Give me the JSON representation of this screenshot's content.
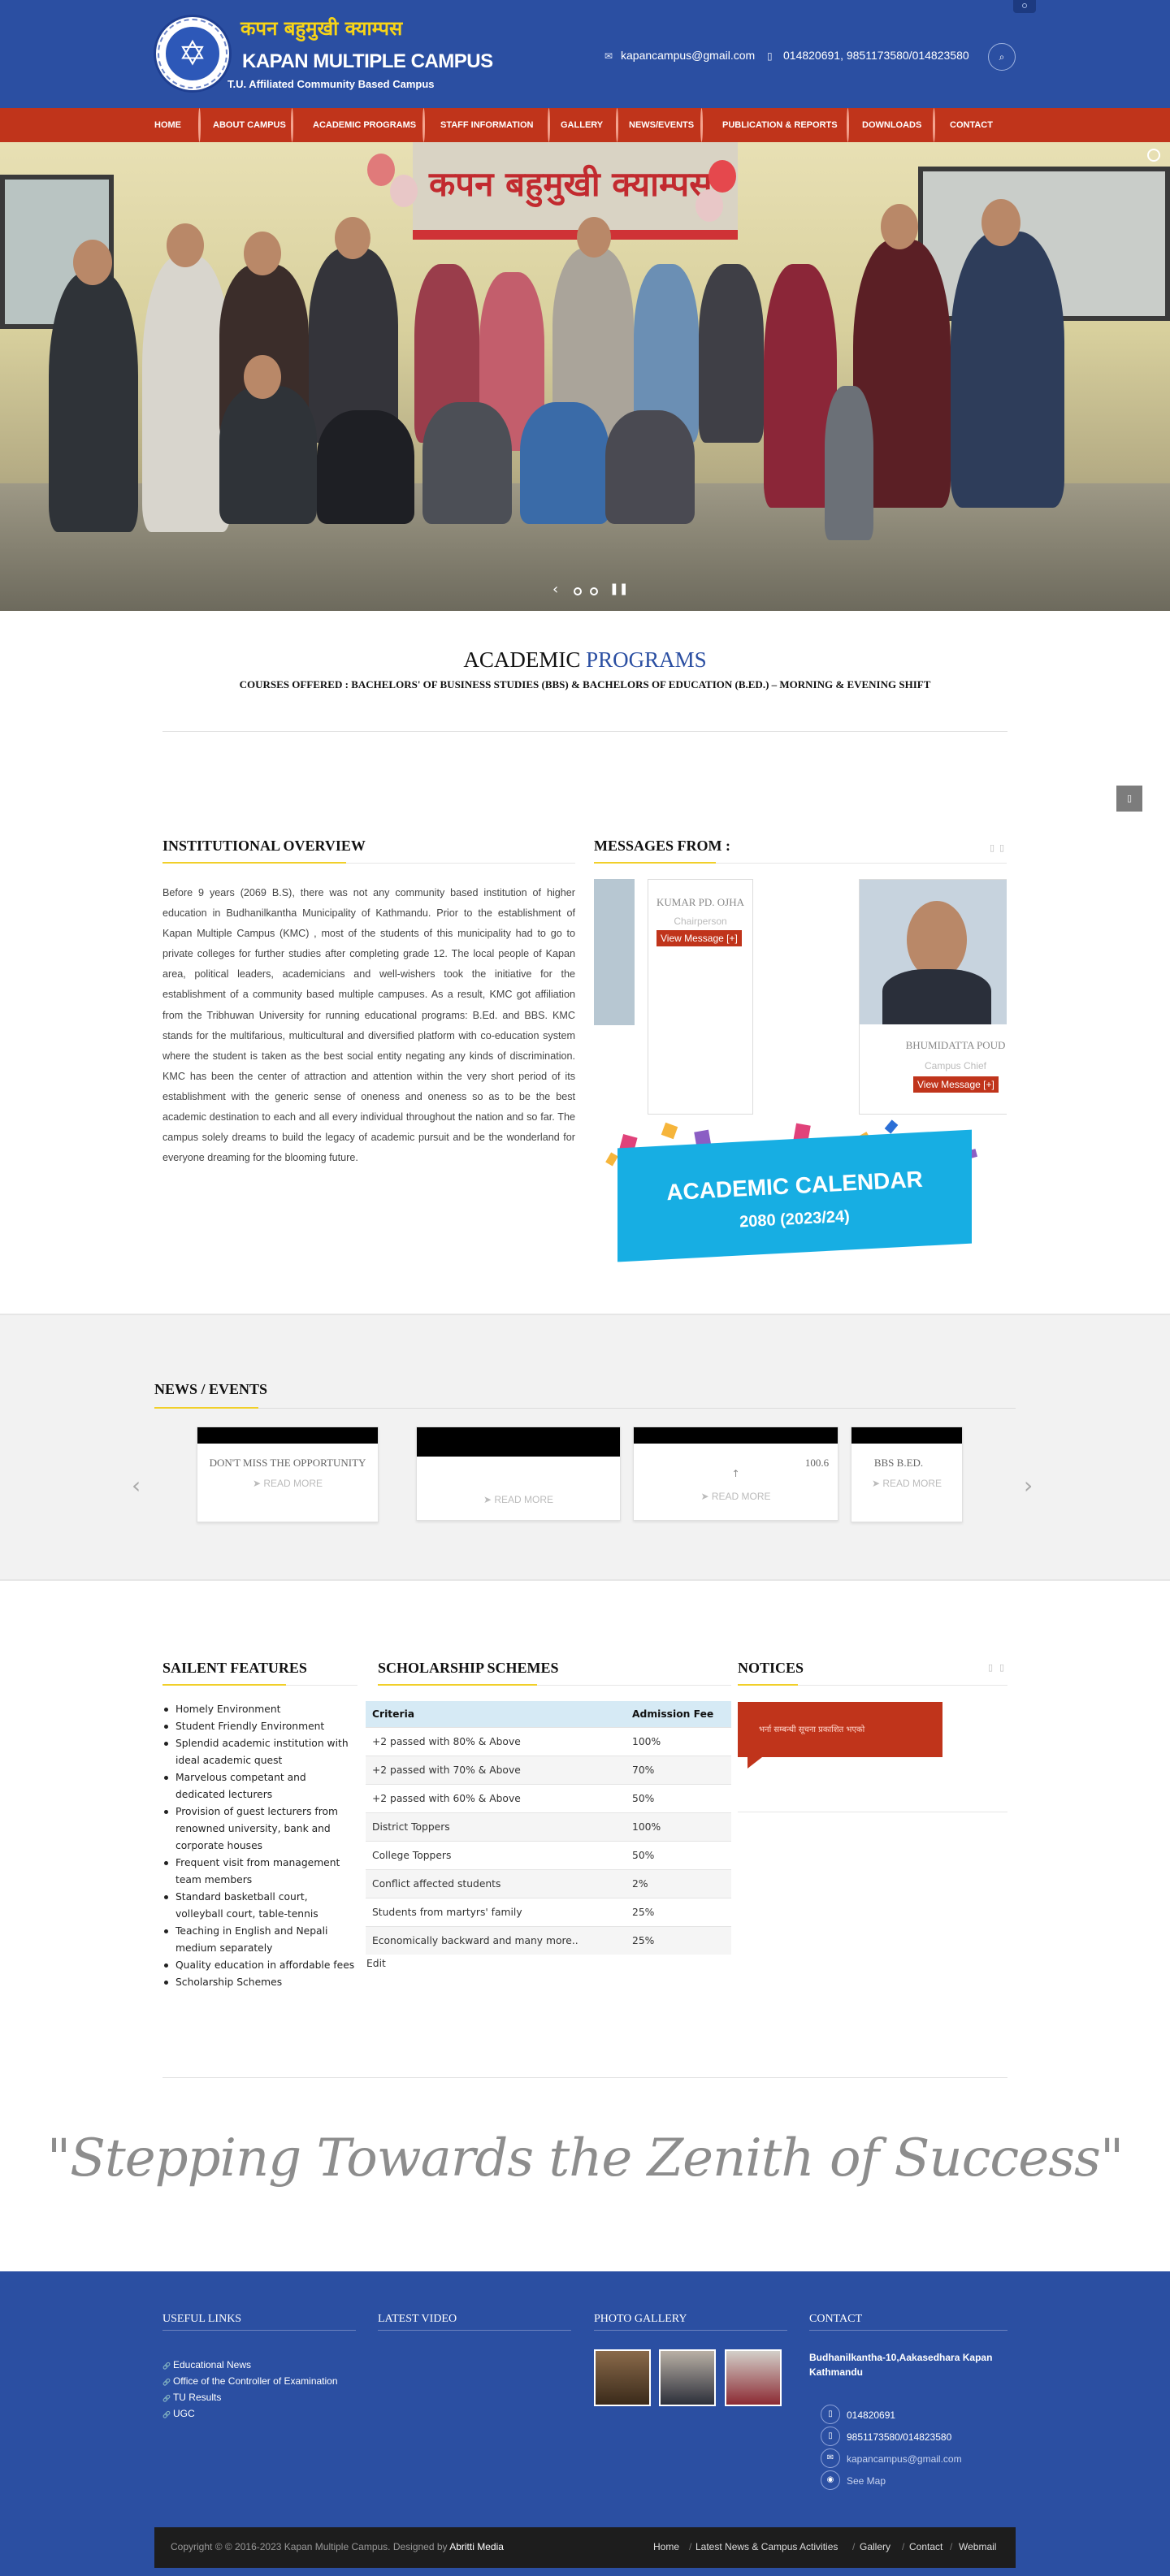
{
  "header": {
    "brand_np": "कपन बहुमुखी क्याम्पस",
    "brand_en": "KAPAN MULTIPLE CAMPUS",
    "tagline": "T.U. Affiliated Community Based Campus",
    "email": "kapancampus@gmail.com",
    "phone": "014820691, 9851173580/014823580"
  },
  "nav": {
    "items": [
      {
        "label": "HOME"
      },
      {
        "label": "ABOUT CAMPUS"
      },
      {
        "label": "ACADEMIC PROGRAMS"
      },
      {
        "label": "STAFF INFORMATION"
      },
      {
        "label": "GALLERY"
      },
      {
        "label": "NEWS/EVENTS"
      },
      {
        "label": "PUBLICATION & REPORTS"
      },
      {
        "label": "DOWNLOADS"
      },
      {
        "label": "CONTACT"
      }
    ]
  },
  "hero": {
    "banner_text": "कपन बहुमुखी क्याम्पस",
    "slide_count": 2
  },
  "academic": {
    "title_a": "ACADEMIC",
    "title_b": "PROGRAMS",
    "subtitle": "COURSES OFFERED : BACHELORS' OF BUSINESS STUDIES (BBS) & BACHELORS OF EDUCATION (B.ED.) – MORNING & EVENING SHIFT"
  },
  "overview": {
    "heading": "INSTITUTIONAL OVERVIEW",
    "text": "Before 9 years (2069 B.S), there was not any community based institution of higher education in Budhanilkantha Municipality of Kathmandu. Prior to the establishment of Kapan Multiple Campus (KMC) , most of the students of this municipality had to go to private colleges for further studies after completing grade 12. The local people of Kapan area, political leaders, academicians and well-wishers took the initiative for the establishment of a community based multiple campuses. As a result, KMC got affiliation from the Tribhuwan University for running educational programs: B.Ed. and BBS. KMC stands for the multifarious, multicultural and diversified platform with co-education system where the student is taken as the best social entity negating any kinds of discrimination. KMC has been the center of attraction and attention within the very short period of its establishment with the generic sense of oneness and oneness so as to be the best academic destination to each and all every individual throughout the nation and so far. The campus solely dreams to build the legacy of academic pursuit and be the wonderland for everyone dreaming for the blooming future."
  },
  "messages": {
    "heading": "MESSAGES FROM :",
    "cards": [
      {
        "name": "KUMAR PD. OJHA",
        "role": "Chairperson",
        "button": "View Message [+]"
      },
      {
        "name": "BHUMIDATTA POUD",
        "role": "Campus Chief",
        "button": "View Message [+]"
      }
    ]
  },
  "calendar": {
    "title": "ACADEMIC CALENDAR",
    "year": "2080 (2023/24)"
  },
  "news": {
    "heading": "NEWS / EVENTS",
    "items": [
      {
        "title": "DON'T MISS THE OPPORTUNITY",
        "more": "➤ READ MORE"
      },
      {
        "title": "",
        "more": "➤ READ MORE"
      },
      {
        "title": "100.6",
        "more": "➤ READ MORE"
      },
      {
        "title": "BBS   B.ED.",
        "more": "➤ READ MORE"
      }
    ]
  },
  "features": {
    "heading": "SAILENT FEATURES",
    "items": [
      "Homely Environment",
      "Student Friendly Environment",
      "Splendid academic institution with ideal academic quest",
      "Marvelous competant and dedicated lecturers",
      "Provision of guest lecturers from renowned university, bank and corporate houses",
      "Frequent visit from management team members",
      "Standard basketball court, volleyball court, table-tennis",
      "Teaching in English and Nepali medium separately",
      "Quality education in affordable fees",
      "Scholarship Schemes"
    ]
  },
  "scholarship": {
    "heading": "SCHOLARSHIP SCHEMES",
    "columns": [
      "Criteria",
      "Admission Fee"
    ],
    "rows": [
      [
        "+2 passed with 80% & Above",
        "100%"
      ],
      [
        "+2 passed with 70% & Above",
        "70%"
      ],
      [
        "+2 passed with 60% & Above",
        "50%"
      ],
      [
        "District Toppers",
        "100%"
      ],
      [
        "College Toppers",
        "50%"
      ],
      [
        "Conflict affected students",
        "2%"
      ],
      [
        "Students from martyrs' family",
        "25%"
      ],
      [
        "Economically backward and many more..",
        "25%"
      ]
    ],
    "edit_label": "Edit"
  },
  "notices": {
    "heading": "NOTICES",
    "item": "भर्ना सम्बन्धी सूचना प्रकाशित भएको"
  },
  "quote": "\"Stepping Towards the Zenith of Success\"",
  "footer": {
    "useful_links_heading": "USEFUL LINKS",
    "links": [
      "Educational News",
      "Office of the Controller of Examination",
      "TU Results",
      "UGC"
    ],
    "video_heading": "LATEST VIDEO",
    "gallery_heading": "PHOTO GALLERY",
    "contact_heading": "CONTACT",
    "address": "Budhanilkantha-10,Aakasedhara Kapan Kathmandu",
    "phone1": "014820691",
    "phone2": "9851173580/014823580",
    "email": "kapancampus@gmail.com",
    "map": "See Map",
    "copyright": "Copyright © © 2016-2023 Kapan Multiple Campus. Designed by",
    "designer": "Abritti Media",
    "bottom_nav": [
      "Home",
      "Latest News & Campus Activities",
      "Gallery",
      "Contact",
      "Webmail"
    ]
  },
  "colors": {
    "brand_blue": "#2b4fa2",
    "nav_red": "#c0341b",
    "accent_yellow": "#f1cf29"
  }
}
